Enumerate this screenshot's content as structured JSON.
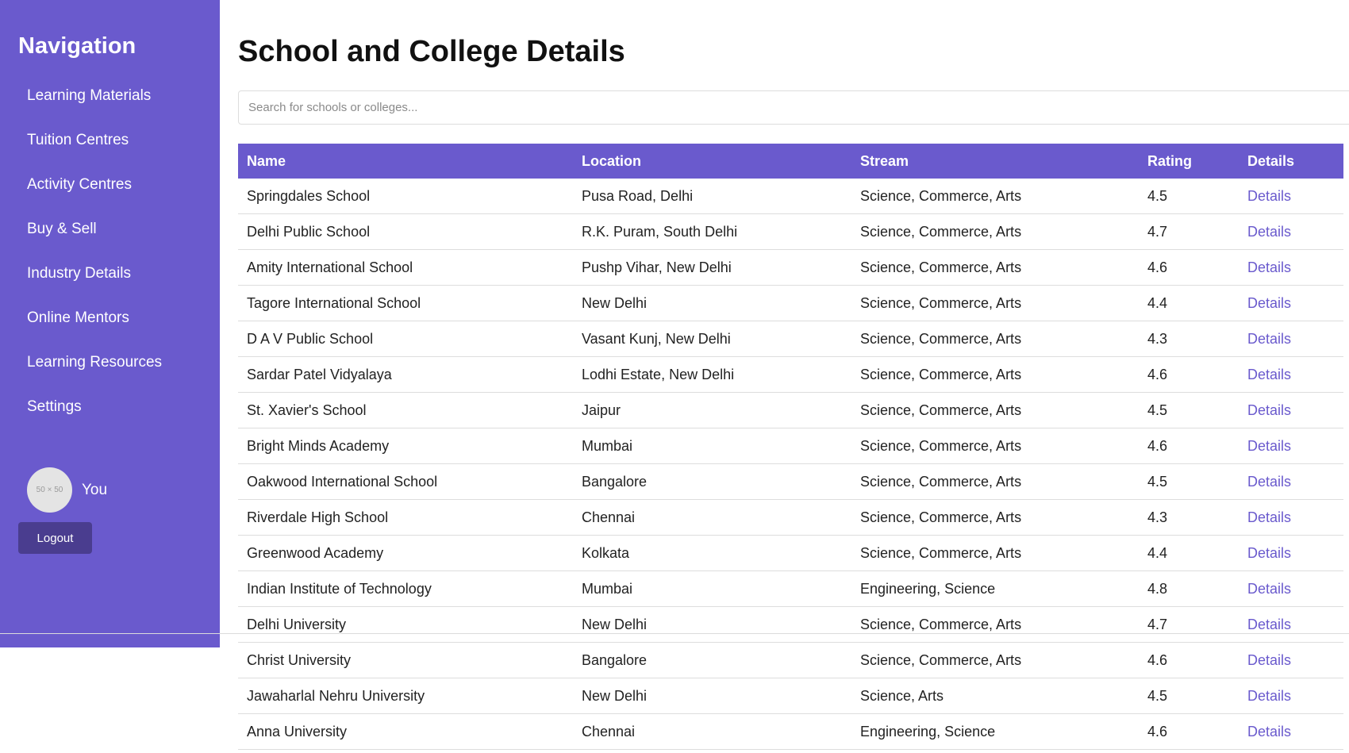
{
  "sidebar": {
    "title": "Navigation",
    "items": [
      {
        "label": "Learning Materials"
      },
      {
        "label": "Tuition Centres"
      },
      {
        "label": "Activity Centres"
      },
      {
        "label": "Buy & Sell"
      },
      {
        "label": "Industry Details"
      },
      {
        "label": "Online Mentors"
      },
      {
        "label": "Learning Resources"
      },
      {
        "label": "Settings"
      }
    ],
    "profile": {
      "avatar_text": "50 × 50",
      "name": "You"
    },
    "logout_label": "Logout"
  },
  "main": {
    "title": "School and College Details",
    "search": {
      "placeholder": "Search for schools or colleges...",
      "value": ""
    },
    "table": {
      "headers": [
        "Name",
        "Location",
        "Stream",
        "Rating",
        "Details"
      ],
      "rows": [
        {
          "name": "Springdales School",
          "location": "Pusa Road, Delhi",
          "stream": "Science, Commerce, Arts",
          "rating": "4.5",
          "details": "Details"
        },
        {
          "name": "Delhi Public School",
          "location": "R.K. Puram, South Delhi",
          "stream": "Science, Commerce, Arts",
          "rating": "4.7",
          "details": "Details"
        },
        {
          "name": "Amity International School",
          "location": "Pushp Vihar, New Delhi",
          "stream": "Science, Commerce, Arts",
          "rating": "4.6",
          "details": "Details"
        },
        {
          "name": "Tagore International School",
          "location": "New Delhi",
          "stream": "Science, Commerce, Arts",
          "rating": "4.4",
          "details": "Details"
        },
        {
          "name": "D A V Public School",
          "location": "Vasant Kunj, New Delhi",
          "stream": "Science, Commerce, Arts",
          "rating": "4.3",
          "details": "Details"
        },
        {
          "name": "Sardar Patel Vidyalaya",
          "location": "Lodhi Estate, New Delhi",
          "stream": "Science, Commerce, Arts",
          "rating": "4.6",
          "details": "Details"
        },
        {
          "name": "St. Xavier's School",
          "location": "Jaipur",
          "stream": "Science, Commerce, Arts",
          "rating": "4.5",
          "details": "Details"
        },
        {
          "name": "Bright Minds Academy",
          "location": "Mumbai",
          "stream": "Science, Commerce, Arts",
          "rating": "4.6",
          "details": "Details"
        },
        {
          "name": "Oakwood International School",
          "location": "Bangalore",
          "stream": "Science, Commerce, Arts",
          "rating": "4.5",
          "details": "Details"
        },
        {
          "name": "Riverdale High School",
          "location": "Chennai",
          "stream": "Science, Commerce, Arts",
          "rating": "4.3",
          "details": "Details"
        },
        {
          "name": "Greenwood Academy",
          "location": "Kolkata",
          "stream": "Science, Commerce, Arts",
          "rating": "4.4",
          "details": "Details"
        },
        {
          "name": "Indian Institute of Technology",
          "location": "Mumbai",
          "stream": "Engineering, Science",
          "rating": "4.8",
          "details": "Details"
        },
        {
          "name": "Delhi University",
          "location": "New Delhi",
          "stream": "Science, Commerce, Arts",
          "rating": "4.7",
          "details": "Details"
        },
        {
          "name": "Christ University",
          "location": "Bangalore",
          "stream": "Science, Commerce, Arts",
          "rating": "4.6",
          "details": "Details"
        },
        {
          "name": "Jawaharlal Nehru University",
          "location": "New Delhi",
          "stream": "Science, Arts",
          "rating": "4.5",
          "details": "Details"
        },
        {
          "name": "Anna University",
          "location": "Chennai",
          "stream": "Engineering, Science",
          "rating": "4.6",
          "details": "Details"
        }
      ]
    }
  },
  "colors": {
    "accent": "#6a5acd",
    "logout_button": "#4a3d8f",
    "link": "#6a5acd"
  }
}
